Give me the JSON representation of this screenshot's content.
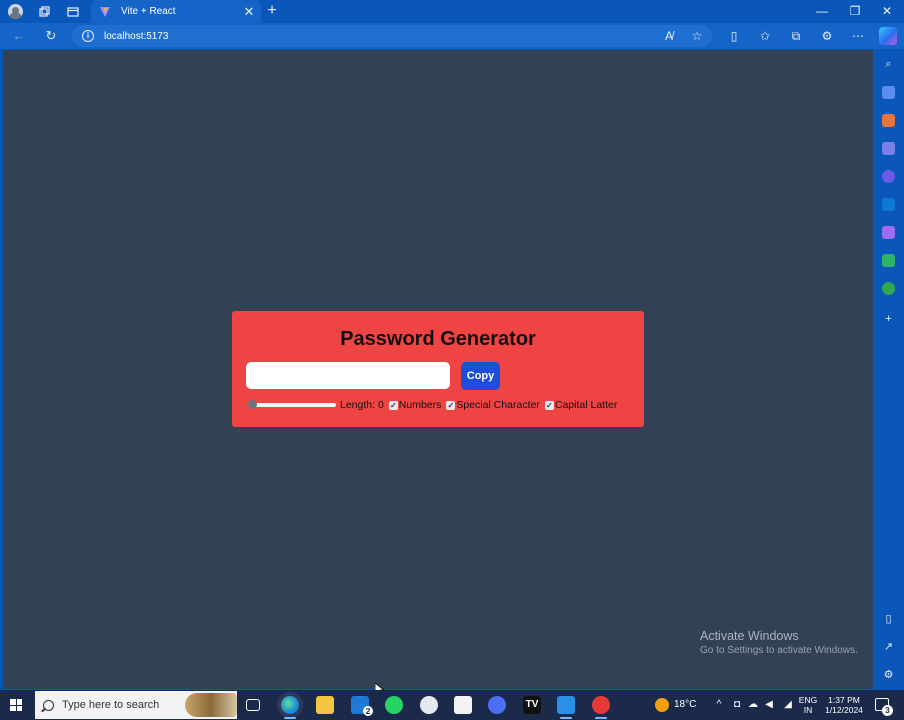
{
  "browser": {
    "tab_title": "Vite + React",
    "url": "localhost:5173"
  },
  "app": {
    "title": "Password Generator",
    "password_value": "",
    "copy_label": "Copy",
    "length_label": "Length: 0",
    "length_value": 0,
    "options": [
      {
        "label": "Numbers",
        "checked": true
      },
      {
        "label": "Special Character",
        "checked": true
      },
      {
        "label": "Capital Latter",
        "checked": true
      }
    ]
  },
  "watermark": {
    "title": "Activate Windows",
    "subtitle": "Go to Settings to activate Windows."
  },
  "taskbar": {
    "search_placeholder": "Type here to search",
    "mail_badge": "2",
    "temperature": "18°C",
    "language": "ENG",
    "region": "IN",
    "time": "1:37 PM",
    "date": "1/12/2024",
    "notification_count": "3"
  },
  "colors": {
    "page_bg": "#334155",
    "card_bg": "#ef4444",
    "button_bg": "#1d4ed8",
    "browser_chrome": "#0b57b9",
    "taskbar_bg": "#1b2a4a"
  }
}
